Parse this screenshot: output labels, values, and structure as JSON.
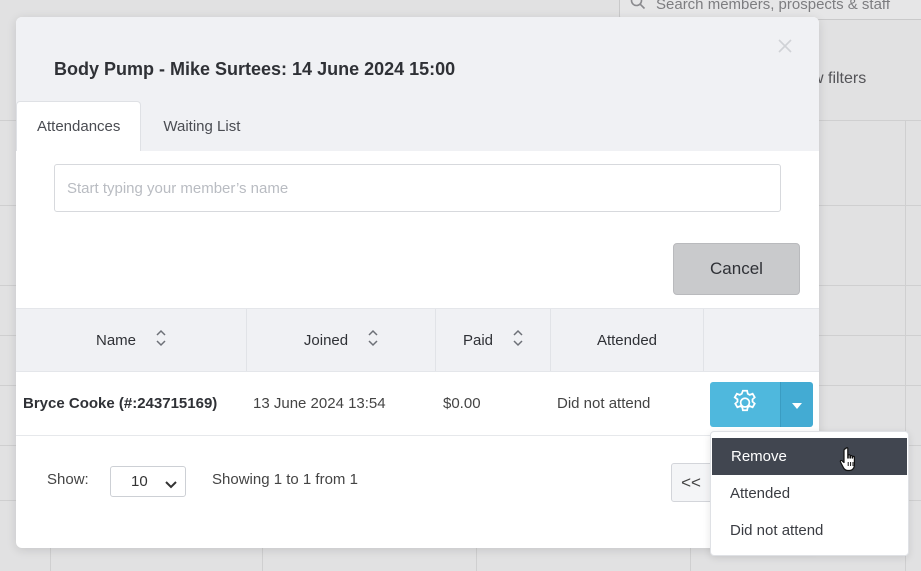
{
  "background": {
    "search_placeholder": "Search members, prospects & staff",
    "filters_label": "w filters",
    "partial_label": "s"
  },
  "modal": {
    "title": "Body Pump - Mike Surtees: 14 June 2024 15:00",
    "tabs": [
      {
        "label": "Attendances",
        "active": true
      },
      {
        "label": "Waiting List",
        "active": false
      }
    ],
    "search_placeholder": "Start typing your member’s name",
    "cancel_label": "Cancel",
    "table": {
      "headers": [
        "Name",
        "Joined",
        "Paid",
        "Attended",
        ""
      ],
      "rows": [
        {
          "name": "Bryce Cooke (#:243715169)",
          "joined": "13 June 2024 13:54",
          "paid": "$0.00",
          "attended": "Did not attend"
        }
      ]
    },
    "footer": {
      "show_label": "Show:",
      "page_size": "10",
      "showing_text": "Showing 1 to 1 from 1",
      "first_page_label": "<<"
    }
  },
  "action_menu": {
    "items": [
      "Remove",
      "Attended",
      "Did not attend"
    ],
    "hovered": "Remove"
  },
  "colors": {
    "gear_button": "#4fb8dd",
    "menu_hover": "#414650",
    "header_bg": "#f0f1f4",
    "cancel_bg": "#c9cacc"
  },
  "icons": {
    "close": "close-icon",
    "settings": "gear-icon",
    "dropdown": "caret-down-icon",
    "sort": "sort-icon",
    "select_chevron": "chevron-down-icon",
    "search": "search-icon",
    "cursor": "hand-pointer-icon"
  }
}
